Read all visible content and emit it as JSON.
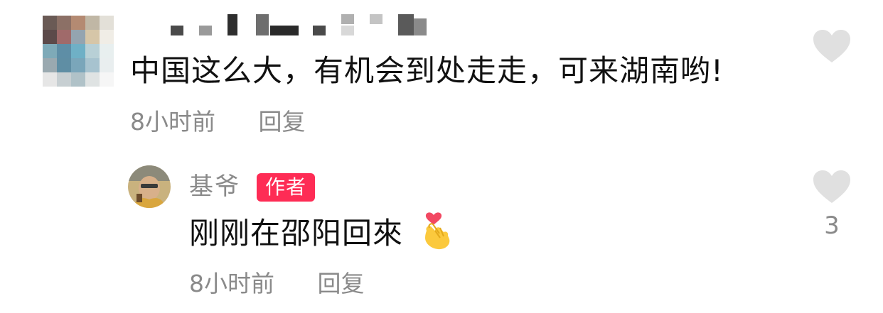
{
  "comment": {
    "text": "中国这么大，有机会到处走走，可来湖南哟!",
    "time": "8小时前",
    "reply_label": "回复",
    "avatar_pixels": [
      "#6a5a55",
      "#8c7066",
      "#b48a72",
      "#c0b7a5",
      "#e3e0d8",
      "#5c4a4a",
      "#a06a6a",
      "#94a4b0",
      "#d6c6a8",
      "#f0ede6",
      "#7eaab8",
      "#5e8ea6",
      "#6fb0c6",
      "#b8d0d6",
      "#e8efef",
      "#9aa9b0",
      "#5f8ea4",
      "#7aa6ba",
      "#a7c3cf",
      "#e9eeef",
      "#e6e6e6",
      "#c7cfd2",
      "#b0c2c8",
      "#dfe3e3",
      "#f6f6f6"
    ]
  },
  "reply": {
    "author_name": "基爷",
    "badge": "作者",
    "text": "刚刚在邵阳回來",
    "emoji": "finger-heart-emoji",
    "time": "8小时前",
    "reply_label": "回复",
    "like_count": "3"
  },
  "colors": {
    "badge_bg": "#fe2c55",
    "like_icon": "#e0e0e0",
    "meta_text": "#8a8a8a"
  }
}
